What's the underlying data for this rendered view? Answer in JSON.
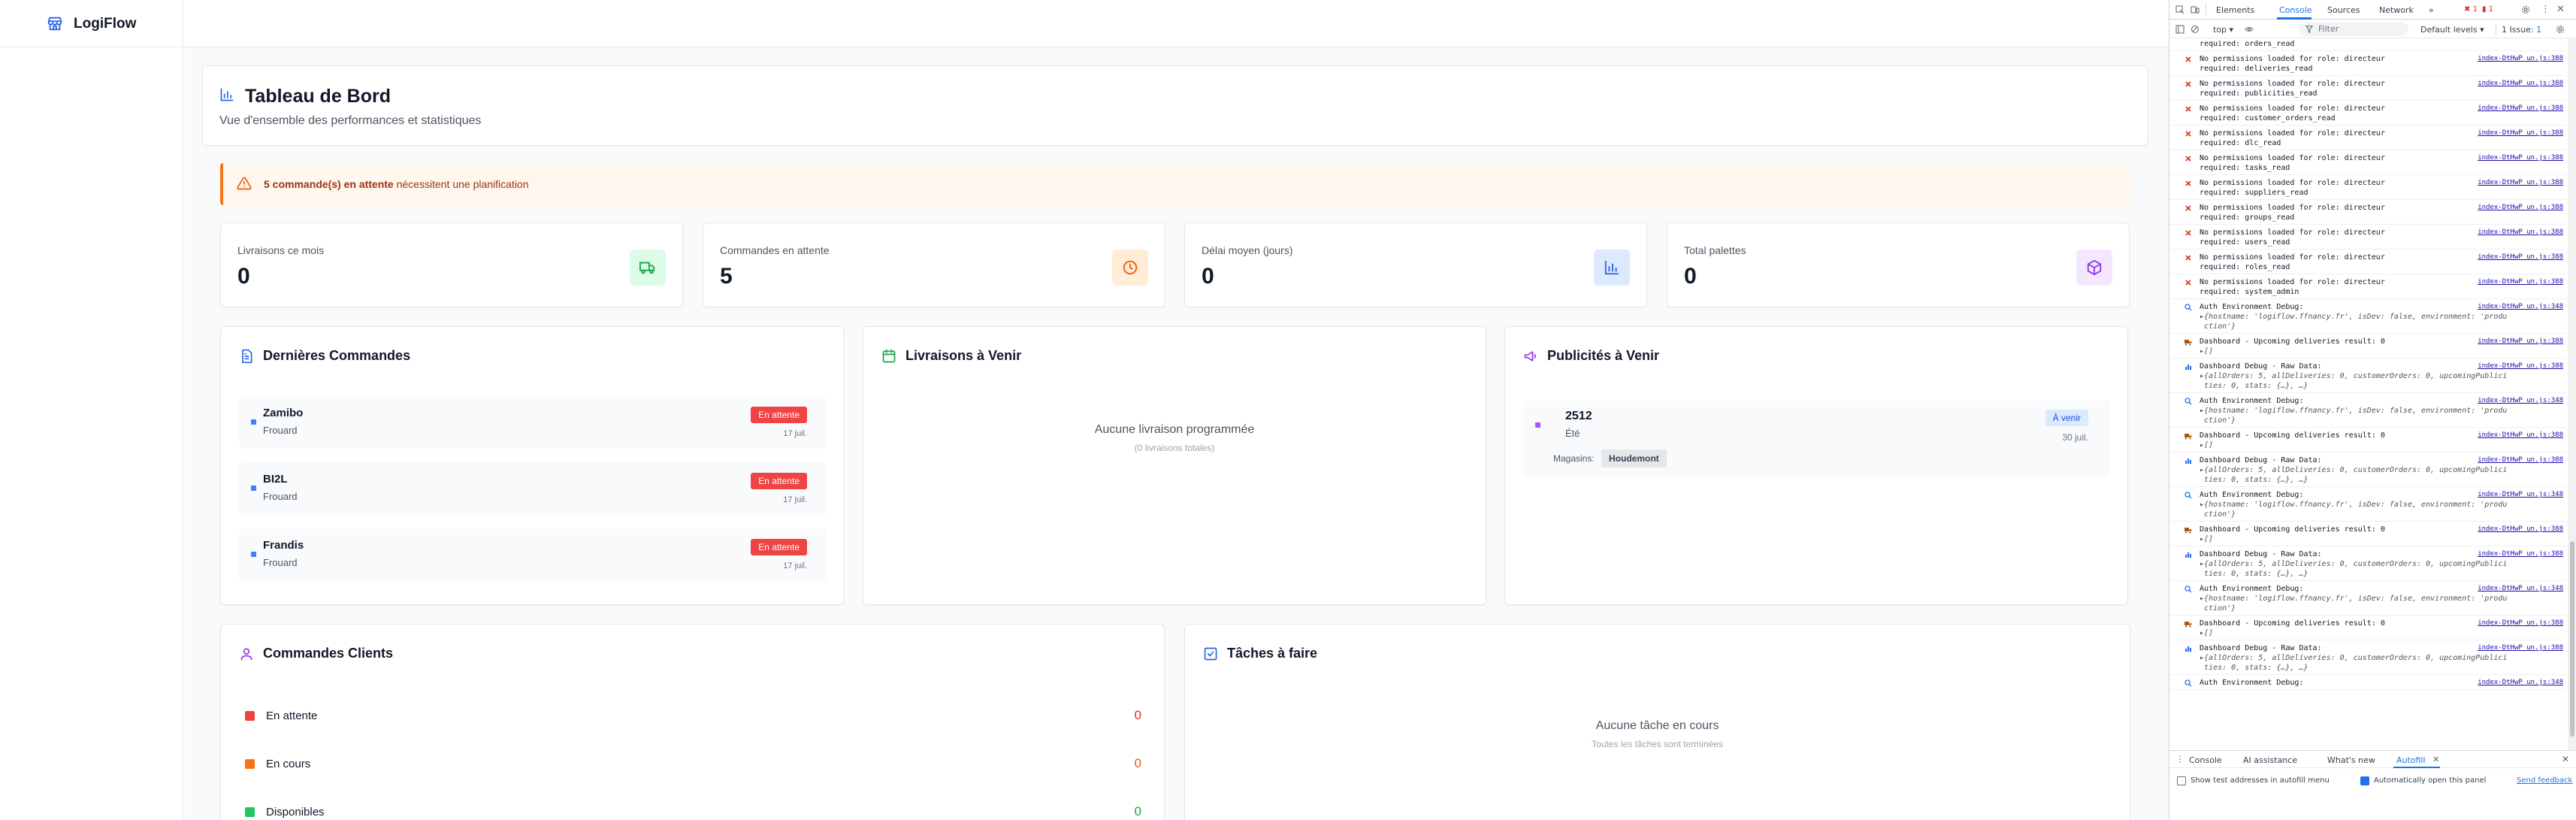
{
  "app": {
    "name": "LogiFlow"
  },
  "dashboard": {
    "title": "Tableau de Bord",
    "subtitle": "Vue d'ensemble des performances et statistiques",
    "alert": {
      "count_text": "5 commande(s) en attente",
      "rest_text": " nécessitent une planification"
    },
    "stats": [
      {
        "label": "Livraisons ce mois",
        "value": "0",
        "icon": "truck-icon",
        "color": "#16a34a",
        "bg": "#dcfce7"
      },
      {
        "label": "Commandes en attente",
        "value": "5",
        "icon": "clock-icon",
        "color": "#ea580c",
        "bg": "#ffedd5"
      },
      {
        "label": "Délai moyen (jours)",
        "value": "0",
        "icon": "bar-chart-icon",
        "color": "#2563eb",
        "bg": "#dbeafe"
      },
      {
        "label": "Total palettes",
        "value": "0",
        "icon": "box-icon",
        "color": "#9333ea",
        "bg": "#f3e8ff"
      }
    ],
    "orders": {
      "title": "Dernières Commandes",
      "items": [
        {
          "name": "Zamibo",
          "sub": "Frouard",
          "badge": "En attente",
          "date": "17 juil."
        },
        {
          "name": "BI2L",
          "sub": "Frouard",
          "badge": "En attente",
          "date": "17 juil."
        },
        {
          "name": "Frandis",
          "sub": "Frouard",
          "badge": "En attente",
          "date": "17 juil."
        }
      ]
    },
    "deliveries": {
      "title": "Livraisons à Venir",
      "empty_title": "Aucune livraison programmée",
      "empty_sub": "(0 livraisons totales)"
    },
    "publicities": {
      "title": "Publicités à Venir",
      "items": [
        {
          "name": "2512",
          "sub": "Été",
          "badge": "À venir",
          "date": "30 juil.",
          "stores_label": "Magasins:",
          "store": "Houdemont"
        }
      ]
    },
    "client_orders": {
      "title": "Commandes Clients",
      "rows": [
        {
          "label": "En attente",
          "value": "0",
          "color": "#ef4444",
          "value_color": "#dc2626"
        },
        {
          "label": "En cours",
          "value": "0",
          "color": "#f97316",
          "value_color": "#ea580c"
        },
        {
          "label": "Disponibles",
          "value": "0",
          "color": "#22c55e",
          "value_color": "#16a34a"
        }
      ]
    },
    "tasks": {
      "title": "Tâches à faire",
      "empty_title": "Aucune tâche en cours",
      "empty_sub": "Toutes les tâches sont terminées"
    }
  },
  "devtools": {
    "tabs": [
      "Elements",
      "Console",
      "Sources",
      "Network"
    ],
    "active_tab": "Console",
    "error_count": "1",
    "warn_count": "1",
    "context": "top",
    "filter_placeholder": "Filter",
    "levels": "Default levels",
    "issues": "1 Issue:",
    "issues_count": "1",
    "logs": [
      {
        "type": "plain",
        "l1": "required: orders_read",
        "l2": "",
        "src": ""
      },
      {
        "type": "err",
        "l1": "No permissions loaded for role: directeur",
        "l2": "required: deliveries_read",
        "src": "index-DtHwP_un.js:388"
      },
      {
        "type": "err",
        "l1": "No permissions loaded for role: directeur",
        "l2": "required: publicities_read",
        "src": "index-DtHwP_un.js:388"
      },
      {
        "type": "err",
        "l1": "No permissions loaded for role: directeur",
        "l2": "required: customer_orders_read",
        "src": "index-DtHwP_un.js:388"
      },
      {
        "type": "err",
        "l1": "No permissions loaded for role: directeur",
        "l2": "required: dlc_read",
        "src": "index-DtHwP_un.js:388"
      },
      {
        "type": "err",
        "l1": "No permissions loaded for role: directeur",
        "l2": "required: tasks_read",
        "src": "index-DtHwP_un.js:388"
      },
      {
        "type": "err",
        "l1": "No permissions loaded for role: directeur",
        "l2": "required: suppliers_read",
        "src": "index-DtHwP_un.js:388"
      },
      {
        "type": "err",
        "l1": "No permissions loaded for role: directeur",
        "l2": "required: groups_read",
        "src": "index-DtHwP_un.js:388"
      },
      {
        "type": "err",
        "l1": "No permissions loaded for role: directeur",
        "l2": "required: users_read",
        "src": "index-DtHwP_un.js:388"
      },
      {
        "type": "err",
        "l1": "No permissions loaded for role: directeur",
        "l2": "required: roles_read",
        "src": "index-DtHwP_un.js:388"
      },
      {
        "type": "err",
        "l1": "No permissions loaded for role: directeur",
        "l2": "required: system_admin",
        "src": "index-DtHwP_un.js:388"
      },
      {
        "type": "auth",
        "l1": "Auth Environment Debug:",
        "l2": "{hostname: 'logiflow.ffnancy.fr', isDev: false, environment: 'produ",
        "l3": "ction'}",
        "src": "index-DtHwP_un.js:348"
      },
      {
        "type": "dash",
        "l1": "Dashboard - Upcoming deliveries result: 0",
        "l2": "[]",
        "src": "index-DtHwP_un.js:388"
      },
      {
        "type": "raw",
        "l1": "Dashboard Debug - Raw Data:",
        "l2": "{allOrders: 5, allDeliveries: 0, customerOrders: 0, upcomingPublici",
        "l3": "ties: 0, stats: {…}, …}",
        "src": "index-DtHwP_un.js:388"
      },
      {
        "type": "auth",
        "l1": "Auth Environment Debug:",
        "l2": "{hostname: 'logiflow.ffnancy.fr', isDev: false, environment: 'produ",
        "l3": "ction'}",
        "src": "index-DtHwP_un.js:348"
      },
      {
        "type": "dash",
        "l1": "Dashboard - Upcoming deliveries result: 0",
        "l2": "[]",
        "src": "index-DtHwP_un.js:388"
      },
      {
        "type": "raw",
        "l1": "Dashboard Debug - Raw Data:",
        "l2": "{allOrders: 5, allDeliveries: 0, customerOrders: 0, upcomingPublici",
        "l3": "ties: 0, stats: {…}, …}",
        "src": "index-DtHwP_un.js:388"
      },
      {
        "type": "auth",
        "l1": "Auth Environment Debug:",
        "l2": "{hostname: 'logiflow.ffnancy.fr', isDev: false, environment: 'produ",
        "l3": "ction'}",
        "src": "index-DtHwP_un.js:348"
      },
      {
        "type": "dash",
        "l1": "Dashboard - Upcoming deliveries result: 0",
        "l2": "[]",
        "src": "index-DtHwP_un.js:388"
      },
      {
        "type": "raw",
        "l1": "Dashboard Debug - Raw Data:",
        "l2": "{allOrders: 5, allDeliveries: 0, customerOrders: 0, upcomingPublici",
        "l3": "ties: 0, stats: {…}, …}",
        "src": "index-DtHwP_un.js:388"
      },
      {
        "type": "auth",
        "l1": "Auth Environment Debug:",
        "l2": "{hostname: 'logiflow.ffnancy.fr', isDev: false, environment: 'produ",
        "l3": "ction'}",
        "src": "index-DtHwP_un.js:348"
      },
      {
        "type": "dash",
        "l1": "Dashboard - Upcoming deliveries result: 0",
        "l2": "[]",
        "src": "index-DtHwP_un.js:388"
      },
      {
        "type": "raw",
        "l1": "Dashboard Debug - Raw Data:",
        "l2": "{allOrders: 5, allDeliveries: 0, customerOrders: 0, upcomingPublici",
        "l3": "ties: 0, stats: {…}, …}",
        "src": "index-DtHwP_un.js:388"
      },
      {
        "type": "auth",
        "l1": "Auth Environment Debug:",
        "l2": "",
        "src": "index-DtHwP_un.js:348"
      }
    ],
    "drawer_tabs": [
      "Console",
      "AI assistance",
      "What's new",
      "Autofill"
    ],
    "drawer_active": "Autofill",
    "autofill": {
      "show_test": "Show test addresses in autofill menu",
      "auto_open": "Automatically open this panel",
      "feedback": "Send feedback"
    }
  }
}
